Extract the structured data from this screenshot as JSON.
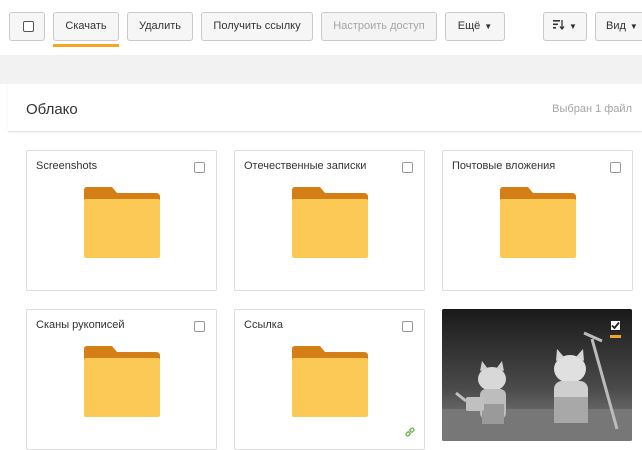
{
  "toolbar": {
    "download_label": "Скачать",
    "delete_label": "Удалить",
    "get_link_label": "Получить ссылку",
    "access_label": "Настроить доступ",
    "more_label": "Ещё",
    "view_label": "Вид",
    "sort_icon": "sort-icon",
    "accent_color": "#f5a623"
  },
  "header": {
    "title": "Облако",
    "selected_text": "Выбран 1 файл"
  },
  "items": [
    {
      "name": "Screenshots",
      "type": "folder",
      "checked": false
    },
    {
      "name": "Отечественные записки",
      "type": "folder",
      "checked": false
    },
    {
      "name": "Почтовые вложения",
      "type": "folder",
      "checked": false
    },
    {
      "name": "Сканы рукописей",
      "type": "folder",
      "checked": false
    },
    {
      "name": "Ссылка",
      "type": "folder",
      "checked": false,
      "shared_link": true
    },
    {
      "name": "",
      "type": "image",
      "checked": true
    }
  ],
  "colors": {
    "folder_front": "#fdc956",
    "folder_back": "#d47f16",
    "link_icon": "#6ab04c"
  }
}
